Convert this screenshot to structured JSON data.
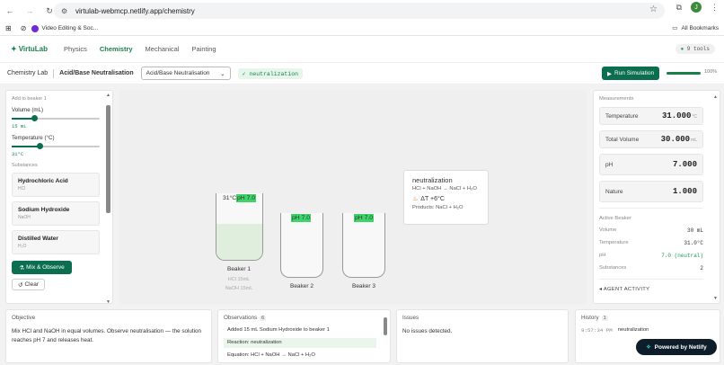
{
  "browser": {
    "url": "virtulab-webmcp.netlify.app/chemistry",
    "bookmark_label": "Video Editing & Soc...",
    "all_bookmarks": "All Bookmarks",
    "avatar_letter": "J"
  },
  "app": {
    "logo": "VirtuLab",
    "nav": [
      "Physics",
      "Chemistry",
      "Mechanical",
      "Painting"
    ],
    "active_nav": "Chemistry",
    "tools_badge": "9 tools"
  },
  "toolbar": {
    "crumb_lab": "Chemistry Lab",
    "crumb_experiment": "Acid/Base Neutralisation",
    "select_value": "Acid/Base Neutralisation",
    "tag": "✓ neutralization",
    "run_label": "Run Simulation",
    "progress_label": "100%",
    "progress": 1.0
  },
  "left_panel": {
    "add_label": "Add to beaker 1",
    "volume_label": "Volume (mL)",
    "volume_value": "15 mL",
    "volume_fraction": 0.25,
    "temp_label": "Temperature (°C)",
    "temp_value": "31°C",
    "temp_fraction": 0.32,
    "substances_label": "Substances",
    "substances": [
      {
        "name": "Hydrochloric Acid",
        "formula": "HCl"
      },
      {
        "name": "Sodium Hydroxide",
        "formula": "NaOH"
      },
      {
        "name": "Distilled Water",
        "formula": "H₂O"
      }
    ],
    "mix_label": "Mix & Observe",
    "clear_label": "Clear"
  },
  "sim": {
    "beakers": [
      {
        "name": "Beaker 1",
        "ph": "pH 7.0",
        "temp": "31°C",
        "contents": "HCl 15mL",
        "contents2": "NaOH 15mL"
      },
      {
        "name": "Beaker 2",
        "ph": "pH 7.0"
      },
      {
        "name": "Beaker 3",
        "ph": "pH 7.0"
      }
    ],
    "reaction": {
      "title": "neutralization",
      "equation": "HCl + NaOH → NaCl + H₂O",
      "delta_t": "ΔT +6°C",
      "products": "Products: NaCl + H₂O"
    }
  },
  "measurements": {
    "title": "Measurements",
    "items": [
      {
        "label": "Temperature",
        "value": "31.000",
        "unit": "°C"
      },
      {
        "label": "Total Volume",
        "value": "30.000",
        "unit": "mL"
      },
      {
        "label": "pH",
        "value": "7.000",
        "unit": ""
      },
      {
        "label": "Nature",
        "value": "1.000",
        "unit": ""
      }
    ]
  },
  "active_beaker": {
    "title": "Active Beaker",
    "rows": [
      {
        "key": "Volume",
        "value": "30 mL"
      },
      {
        "key": "Temperature",
        "value": "31.0°C"
      },
      {
        "key": "pH",
        "value": "7.0 (neutral)"
      },
      {
        "key": "Substances",
        "value": "2"
      }
    ],
    "agent_activity": "AGENT ACTIVITY"
  },
  "bottom": {
    "objective_title": "Objective",
    "objective_text": "Mix HCl and NaOH in equal volumes. Observe neutralisation — the solution reaches pH 7 and releases heat.",
    "observations_title": "Observations",
    "observations_count": "6",
    "observations": [
      "Added 15 mL Sodium Hydroxide to beaker 1",
      "Reaction: neutralization",
      "Equation: HCl + NaOH → NaCl + H₂O"
    ],
    "issues_title": "Issues",
    "issues_text": "No issues detected.",
    "history_title": "History",
    "history_count": "1",
    "history": [
      {
        "time": "9:57:34 PM",
        "event": "neutralization"
      }
    ],
    "powered_by": "Powered by Netlify"
  },
  "colors": {
    "accent": "#0b6e4f",
    "ph_tag": "#3fd46a",
    "liquid": "#dfeedd"
  }
}
